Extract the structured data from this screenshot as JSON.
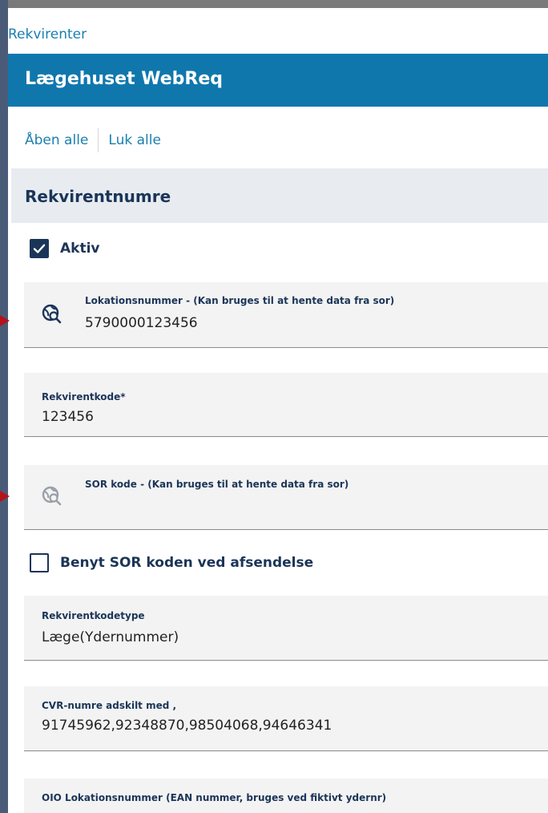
{
  "breadcrumb": "Rekvirenter",
  "header": {
    "title": "Lægehuset WebReq"
  },
  "toggles": {
    "open_all": "Åben alle",
    "close_all": "Luk alle"
  },
  "section": {
    "title": "Rekvirentnumre"
  },
  "active_checkbox": {
    "label": "Aktiv",
    "checked": true
  },
  "fields": {
    "location": {
      "label": "Lokationsnummer - (Kan bruges til at hente data fra sor)",
      "value": "5790000123456"
    },
    "req_code": {
      "label": "Rekvirentkode*",
      "value": "123456"
    },
    "sor_code": {
      "label": "SOR kode - (Kan bruges til at hente data fra sor)",
      "value": ""
    },
    "req_code_type": {
      "label": "Rekvirentkodetype",
      "value": "Læge(Ydernummer)"
    },
    "cvr": {
      "label": "CVR-numre adskilt med ,",
      "value": "91745962,92348870,98504068,94646341"
    },
    "oio": {
      "label": "OIO Lokationsnummer (EAN nummer, bruges ved fiktivt ydernr)",
      "value": ""
    }
  },
  "sor_checkbox": {
    "label": "Benyt SOR koden ved afsendelse",
    "checked": false
  },
  "icons": {
    "lookup": "globe-search-icon",
    "check": "checkmark-icon",
    "arrow": "arrow-right-icon"
  },
  "colors": {
    "primary": "#1077ad",
    "navy": "#1b3558",
    "link": "#1a7fb0",
    "annotation": "#b5121b"
  }
}
